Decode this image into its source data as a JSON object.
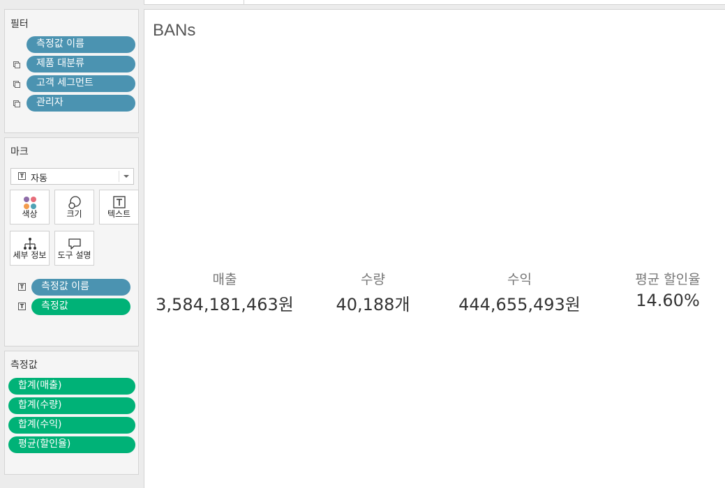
{
  "filters": {
    "title": "필터",
    "items": [
      {
        "label": "측정값 이름",
        "icon": null
      },
      {
        "label": "제품 대분류",
        "icon": "filter-icon"
      },
      {
        "label": "고객 세그먼트",
        "icon": "filter-icon"
      },
      {
        "label": "관리자",
        "icon": "filter-icon"
      }
    ]
  },
  "marks": {
    "title": "마크",
    "type_select": "자동",
    "buttons": {
      "color": "색상",
      "size": "크기",
      "text": "텍스트",
      "detail": "세부 정보",
      "tooltip": "도구 설명"
    },
    "cards": [
      {
        "label": "측정값 이름"
      },
      {
        "label": "측정값"
      }
    ]
  },
  "measures": {
    "title": "측정값",
    "items": [
      "합계(매출)",
      "합계(수량)",
      "합계(수익)",
      "평균(할인율)"
    ]
  },
  "sheet": {
    "title": "BANs",
    "bans": [
      {
        "label": "매출",
        "value": "3,584,181,463원"
      },
      {
        "label": "수량",
        "value": "40,188개"
      },
      {
        "label": "수익",
        "value": "444,655,493원"
      },
      {
        "label": "평균 할인율",
        "value": "14.60%"
      }
    ]
  },
  "colors": {
    "dimension_pill": "#4b93b1",
    "measure_pill": "#00b277",
    "panel_bg": "#f5f5f5"
  }
}
